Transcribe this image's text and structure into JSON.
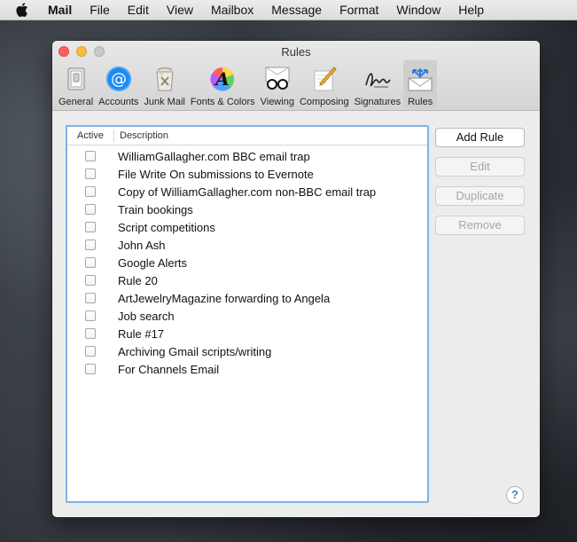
{
  "menubar": {
    "app_name": "Mail",
    "items": [
      "File",
      "Edit",
      "View",
      "Mailbox",
      "Message",
      "Format",
      "Window",
      "Help"
    ]
  },
  "window": {
    "title": "Rules",
    "toolbar": [
      {
        "label": "General",
        "icon": "switch-icon"
      },
      {
        "label": "Accounts",
        "icon": "at-sign-icon"
      },
      {
        "label": "Junk Mail",
        "icon": "trash-icon"
      },
      {
        "label": "Fonts & Colors",
        "icon": "fonts-colors-icon"
      },
      {
        "label": "Viewing",
        "icon": "glasses-icon"
      },
      {
        "label": "Composing",
        "icon": "pencil-icon"
      },
      {
        "label": "Signatures",
        "icon": "signature-icon"
      },
      {
        "label": "Rules",
        "icon": "rules-envelope-icon",
        "selected": true
      }
    ]
  },
  "rules_table": {
    "headers": {
      "active": "Active",
      "description": "Description"
    },
    "rules": [
      {
        "active": false,
        "description": "WilliamGallagher.com BBC email trap"
      },
      {
        "active": false,
        "description": "File Write On submissions to Evernote"
      },
      {
        "active": false,
        "description": "Copy of WilliamGallagher.com non-BBC email trap"
      },
      {
        "active": false,
        "description": "Train bookings"
      },
      {
        "active": false,
        "description": "Script competitions"
      },
      {
        "active": false,
        "description": "John Ash"
      },
      {
        "active": false,
        "description": "Google Alerts"
      },
      {
        "active": false,
        "description": "Rule 20"
      },
      {
        "active": false,
        "description": "ArtJewelryMagazine forwarding to Angela"
      },
      {
        "active": false,
        "description": "Job search"
      },
      {
        "active": false,
        "description": "Rule #17"
      },
      {
        "active": false,
        "description": "Archiving Gmail scripts/writing"
      },
      {
        "active": false,
        "description": "For Channels Email"
      }
    ]
  },
  "buttons": {
    "add_rule": "Add Rule",
    "edit": "Edit",
    "duplicate": "Duplicate",
    "remove": "Remove"
  },
  "help": {
    "label": "?"
  },
  "colors": {
    "selection_border": "#7fb2e8",
    "close": "#fc605c",
    "minimize": "#fdbc40",
    "accounts_blue": "#1a8cf0"
  }
}
